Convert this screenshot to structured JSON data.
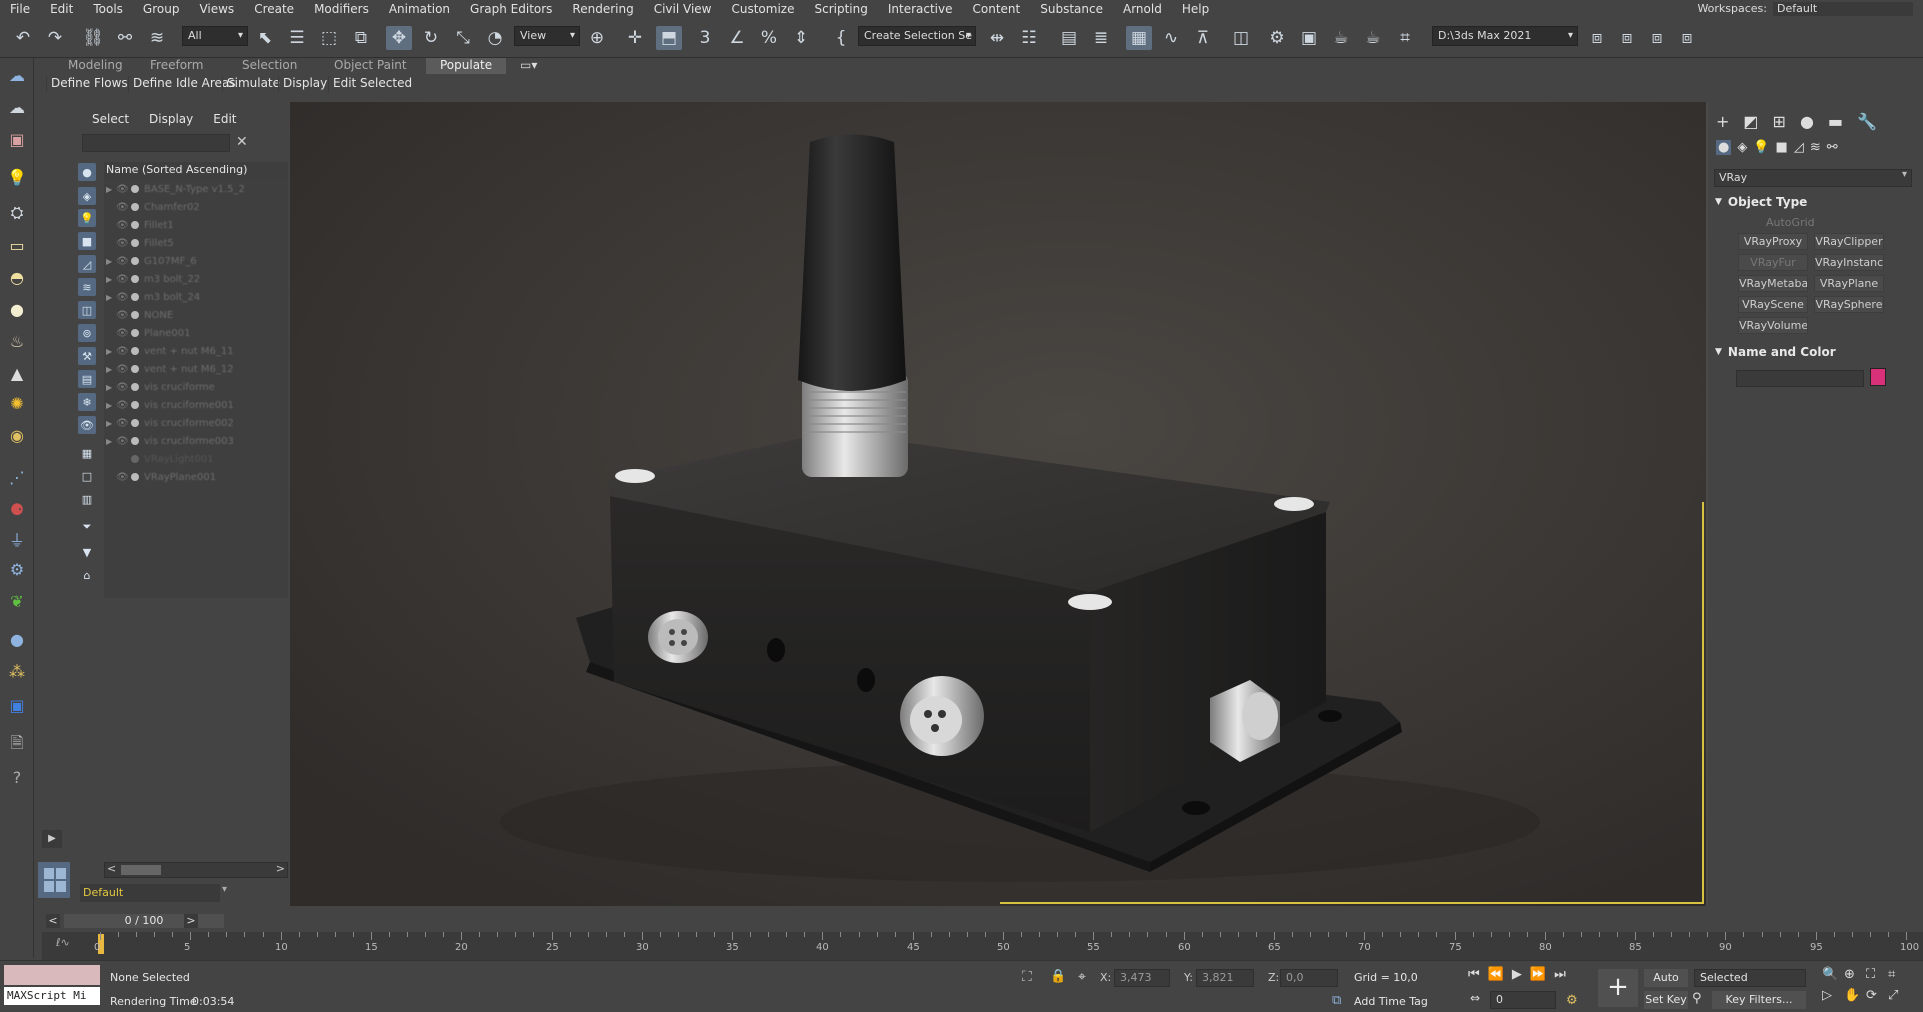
{
  "menubar": {
    "items": [
      "File",
      "Edit",
      "Tools",
      "Group",
      "Views",
      "Create",
      "Modifiers",
      "Animation",
      "Graph Editors",
      "Rendering",
      "Civil View",
      "Customize",
      "Scripting",
      "Interactive",
      "Content",
      "Substance",
      "Arnold",
      "Help"
    ],
    "workspace_label": "Workspaces:",
    "workspace_value": "Default"
  },
  "toolbar": {
    "filter_value": "All",
    "view_value": "View",
    "selection_set_value": "Create Selection Se",
    "project_path": "D:\\3ds Max 2021"
  },
  "ribbon": {
    "tabs": [
      "Modeling",
      "Freeform",
      "Selection",
      "Object Paint",
      "Populate"
    ],
    "active_tab": "Populate",
    "buttons": [
      "Define Flows",
      "Define Idle Areas",
      "Simulate",
      "Display",
      "Edit Selected"
    ]
  },
  "explorer": {
    "menu": [
      "Select",
      "Display",
      "Edit"
    ],
    "column_header": "Name (Sorted Ascending)",
    "items": [
      {
        "name": "BASE_N-Type v1.5_2",
        "expand": true
      },
      {
        "name": "Chamfer02",
        "expand": false
      },
      {
        "name": "Fillet1",
        "expand": false
      },
      {
        "name": "Fillet5",
        "expand": false
      },
      {
        "name": "G107MF_6",
        "expand": true
      },
      {
        "name": "m3 bolt_22",
        "expand": true
      },
      {
        "name": "m3 bolt_24",
        "expand": true
      },
      {
        "name": "NONE",
        "expand": false
      },
      {
        "name": "Plane001",
        "expand": false
      },
      {
        "name": "vent + nut M6_11",
        "expand": true
      },
      {
        "name": "vent + nut M6_12",
        "expand": true
      },
      {
        "name": "vis cruciforme",
        "expand": true
      },
      {
        "name": "vis cruciforme001",
        "expand": true
      },
      {
        "name": "vis cruciforme002",
        "expand": true
      },
      {
        "name": "vis cruciforme003",
        "expand": true
      },
      {
        "name": "VRayLight001",
        "expand": false
      },
      {
        "name": "VRayPlane001",
        "expand": false
      }
    ],
    "layer_value": "Default"
  },
  "command_panel": {
    "renderer_value": "VRay",
    "object_type_title": "Object Type",
    "autogrid_label": "AutoGrid",
    "buttons": [
      "VRayProxy",
      "VRayClipper",
      "VRayFur",
      "VRayInstancer",
      "VRayMetaball",
      "VRayPlane",
      "VRayScene",
      "VRaySphere",
      "VRayVolumeGrid"
    ],
    "name_color_title": "Name and Color",
    "object_color": "#d8317a"
  },
  "timeline": {
    "frame_display": "0 / 100",
    "ticks": [
      "0",
      "5",
      "10",
      "15",
      "20",
      "25",
      "30",
      "35",
      "40",
      "45",
      "50",
      "55",
      "60",
      "65",
      "70",
      "75",
      "80",
      "85",
      "90",
      "95",
      "100"
    ]
  },
  "status": {
    "maxscript_label": "MAXScript Mi",
    "selection_status": "None Selected",
    "render_time_label": "Rendering Time",
    "render_time_value": "0:03:54",
    "x_label": "X:",
    "x_value": "3,473",
    "y_label": "Y:",
    "y_value": "3,821",
    "z_label": "Z:",
    "z_value": "0,0",
    "grid": "Grid = 10,0",
    "add_time_tag": "Add Time Tag",
    "auto_key": "Auto Key",
    "set_key": "Set Key",
    "selected_value": "Selected",
    "key_filters": "Key Filters...",
    "current_frame": "0"
  }
}
